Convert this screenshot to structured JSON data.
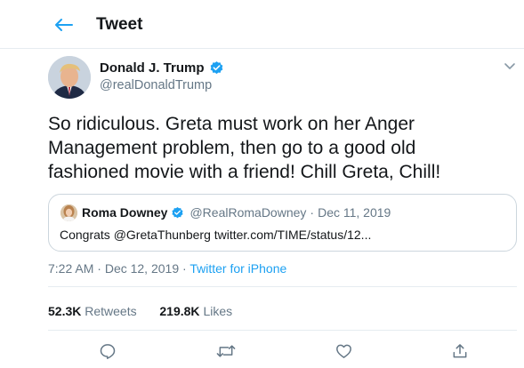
{
  "header": {
    "title": "Tweet"
  },
  "tweet": {
    "display_name": "Donald J. Trump",
    "handle": "@realDonaldTrump",
    "text_lines": [
      "So ridiculous. Greta must work on her Anger",
      "Management problem, then go to a good old",
      "fashioned movie with a friend! Chill Greta, Chill!"
    ],
    "time": "7:22 AM",
    "date": "Dec 12, 2019",
    "separator": "·",
    "source": "Twitter for iPhone"
  },
  "quoted_tweet": {
    "display_name": "Roma Downey",
    "handle": "@RealRomaDowney",
    "separator": "·",
    "date": "Dec 11, 2019",
    "text": "Congrats @GretaThunberg twitter.com/TIME/status/12..."
  },
  "stats": {
    "retweets_count": "52.3K",
    "retweets_label": "Retweets",
    "likes_count": "219.8K",
    "likes_label": "Likes"
  },
  "icons": {
    "back": "arrow-left-icon",
    "verified": "verified-badge-icon",
    "caret": "chevron-down-icon",
    "reply": "reply-icon",
    "retweet": "retweet-icon",
    "like": "heart-icon",
    "share": "share-icon"
  },
  "colors": {
    "accent": "#1da1f2",
    "text": "#14171a",
    "secondary": "#657786",
    "border": "#e6ecf0"
  }
}
